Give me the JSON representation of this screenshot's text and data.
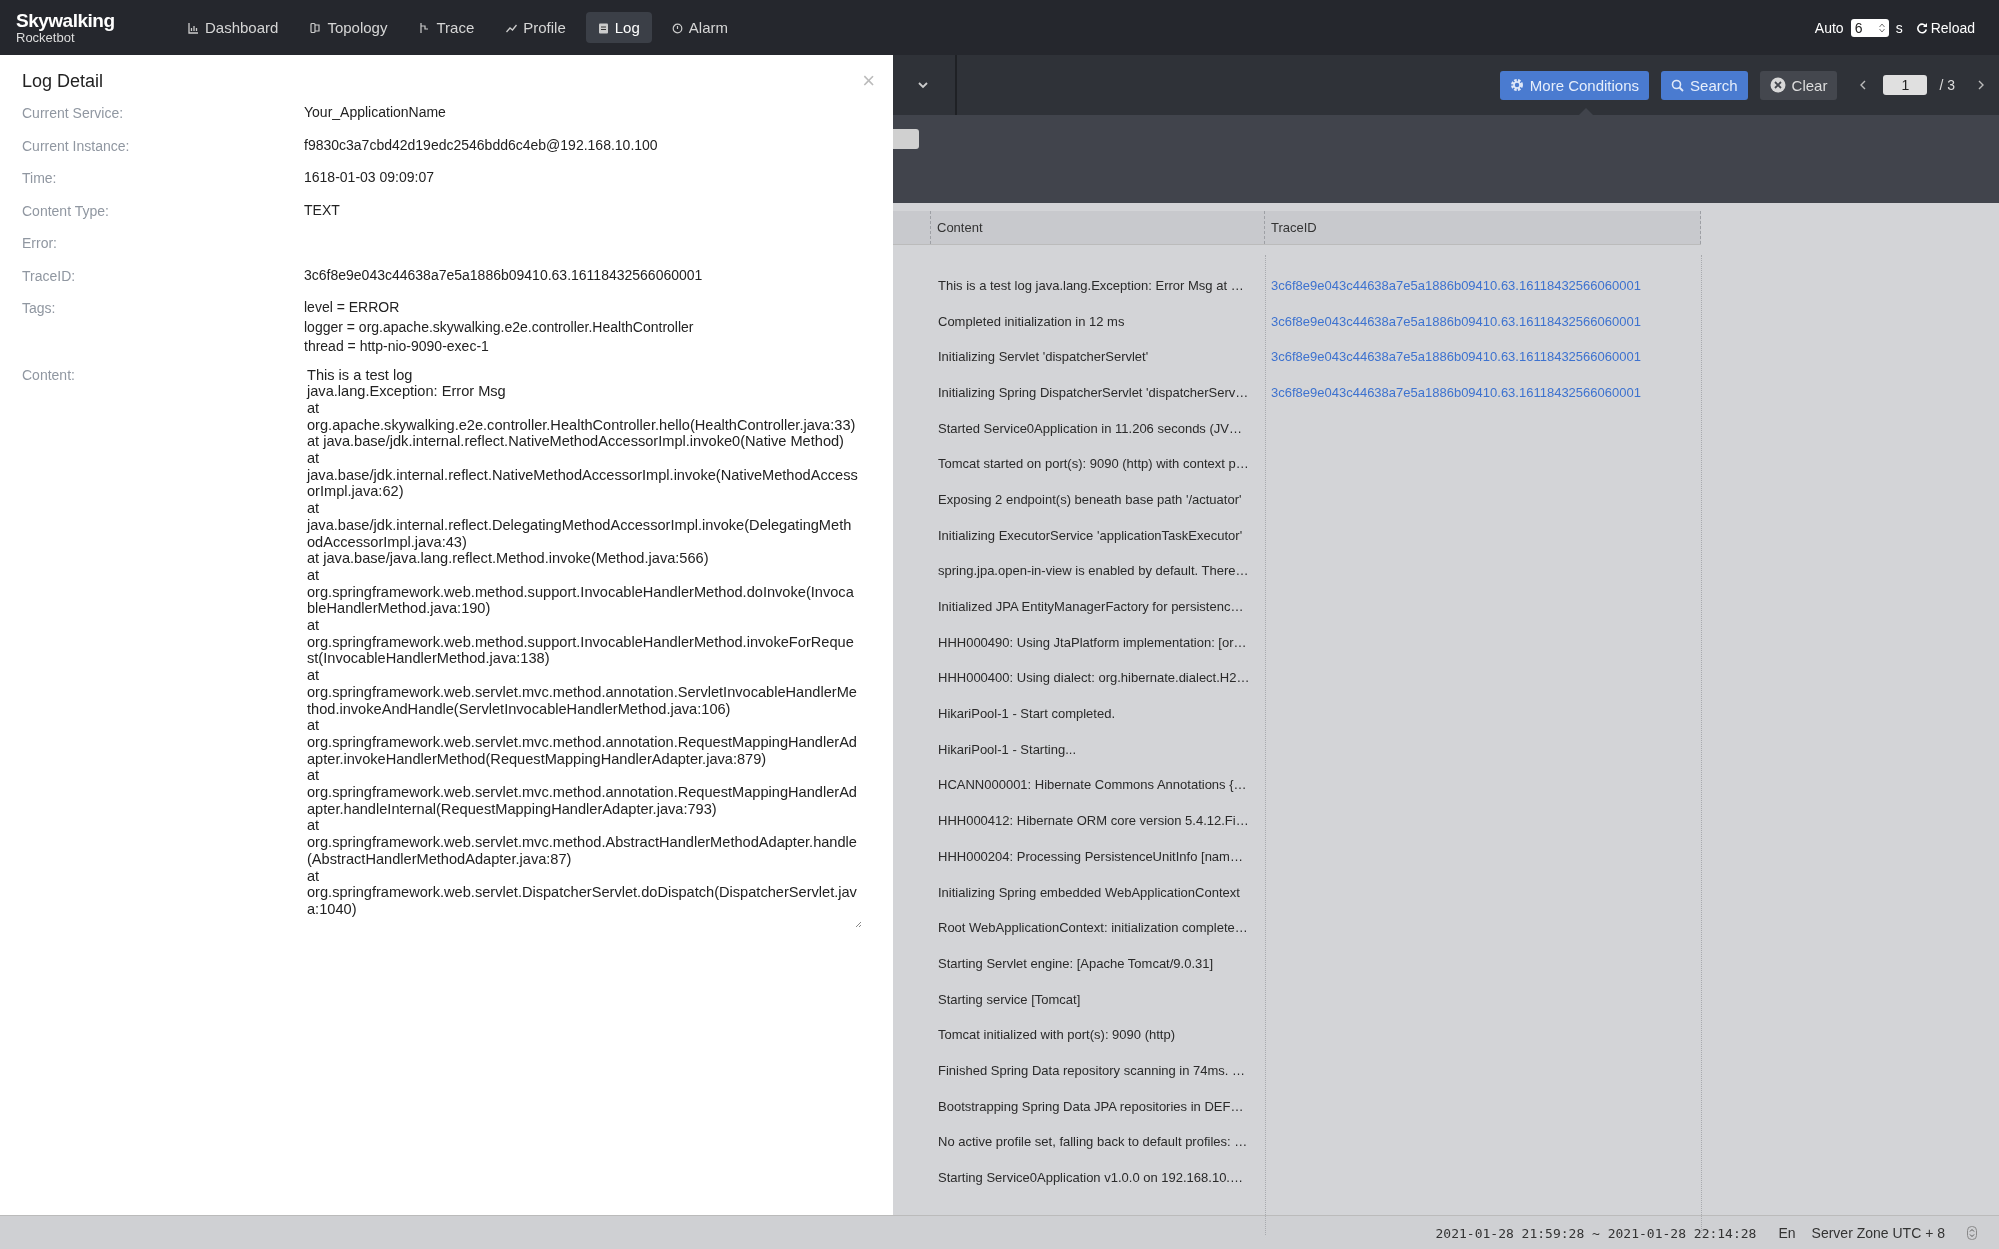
{
  "app": {
    "logo": "Skywalking",
    "subtitle": "Rocketbot"
  },
  "nav": [
    {
      "label": "Dashboard",
      "selected": false
    },
    {
      "label": "Topology",
      "selected": false
    },
    {
      "label": "Trace",
      "selected": false
    },
    {
      "label": "Profile",
      "selected": false
    },
    {
      "label": "Log",
      "selected": true
    },
    {
      "label": "Alarm",
      "selected": false
    }
  ],
  "auto_refresh": {
    "label": "Auto",
    "value": "6",
    "unit": "s",
    "reload": "Reload"
  },
  "toolbar": {
    "buttons": [
      {
        "label": "More Conditions",
        "kind": "primary"
      },
      {
        "label": "Search",
        "kind": "primary"
      },
      {
        "label": "Clear",
        "kind": "dark"
      }
    ],
    "page": "1",
    "page_total": "/ 3"
  },
  "table": {
    "columns": [
      "Content",
      "TraceID"
    ],
    "rows": [
      {
        "content": "This is a test log java.lang.Exception: Error Msg at …",
        "trace_id": "3c6f8e9e043c44638a7e5a1886b09410.63.16118432566060001"
      },
      {
        "content": "Completed initialization in 12 ms",
        "trace_id": "3c6f8e9e043c44638a7e5a1886b09410.63.16118432566060001"
      },
      {
        "content": "Initializing Servlet 'dispatcherServlet'",
        "trace_id": "3c6f8e9e043c44638a7e5a1886b09410.63.16118432566060001"
      },
      {
        "content": "Initializing Spring DispatcherServlet 'dispatcherServ…",
        "trace_id": "3c6f8e9e043c44638a7e5a1886b09410.63.16118432566060001"
      },
      {
        "content": "Started Service0Application in 11.206 seconds (JV…"
      },
      {
        "content": "Tomcat started on port(s): 9090 (http) with context p…"
      },
      {
        "content": "Exposing 2 endpoint(s) beneath base path '/actuator'"
      },
      {
        "content": "Initializing ExecutorService 'applicationTaskExecutor'"
      },
      {
        "content": "spring.jpa.open-in-view is enabled by default. There…"
      },
      {
        "content": "Initialized JPA EntityManagerFactory for persistenc…"
      },
      {
        "content": "HHH000490: Using JtaPlatform implementation: [or…"
      },
      {
        "content": "HHH000400: Using dialect: org.hibernate.dialect.H2…"
      },
      {
        "content": "HikariPool-1 - Start completed."
      },
      {
        "content": "HikariPool-1 - Starting..."
      },
      {
        "content": "HCANN000001: Hibernate Commons Annotations {…"
      },
      {
        "content": "HHH000412: Hibernate ORM core version 5.4.12.Fi…"
      },
      {
        "content": "HHH000204: Processing PersistenceUnitInfo [nam…"
      },
      {
        "content": "Initializing Spring embedded WebApplicationContext"
      },
      {
        "content": "Root WebApplicationContext: initialization complete…"
      },
      {
        "content": "Starting Servlet engine: [Apache Tomcat/9.0.31]"
      },
      {
        "content": "Starting service [Tomcat]"
      },
      {
        "content": "Tomcat initialized with port(s): 9090 (http)"
      },
      {
        "content": "Finished Spring Data repository scanning in 74ms. …"
      },
      {
        "content": "Bootstrapping Spring Data JPA repositories in DEF…"
      },
      {
        "content": "No active profile set, falling back to default profiles: …"
      },
      {
        "content": "Starting Service0Application v1.0.0 on 192.168.10.…"
      }
    ]
  },
  "drawer": {
    "title": "Log Detail",
    "close": "×",
    "fields": [
      {
        "label": "Current Service:",
        "lines": [
          "Your_ApplicationName"
        ]
      },
      {
        "label": "Current Instance:",
        "lines": [
          "f9830c3a7cbd42d19edc2546bdd6c4eb@192.168.10.100"
        ]
      },
      {
        "label": "Time:",
        "lines": [
          "1618-01-03 09:09:07"
        ]
      },
      {
        "label": "Content Type:",
        "lines": [
          "TEXT"
        ]
      },
      {
        "label": "Error:"
      },
      {
        "label": "TraceID:",
        "lines": [
          "3c6f8e9e043c44638a7e5a1886b09410.63.16118432566060001"
        ]
      },
      {
        "label": "Tags:",
        "lines": [
          "level = ERROR",
          "logger = org.apache.skywalking.e2e.controller.HealthController",
          "thread = http-nio-9090-exec-1"
        ]
      }
    ],
    "content_label": "Content:",
    "content": [
      "This is a test log",
      "java.lang.Exception: Error Msg",
      "at org.apache.skywalking.e2e.controller.HealthController.hello(HealthController.java:33)",
      "at java.base/jdk.internal.reflect.NativeMethodAccessorImpl.invoke0(Native Method)",
      "at java.base/jdk.internal.reflect.NativeMethodAccessorImpl.invoke(NativeMethodAccessorImpl.java:62)",
      "at java.base/jdk.internal.reflect.DelegatingMethodAccessorImpl.invoke(DelegatingMethodAccessorImpl.java:43)",
      "at java.base/java.lang.reflect.Method.invoke(Method.java:566)",
      "at org.springframework.web.method.support.InvocableHandlerMethod.doInvoke(InvocableHandlerMethod.java:190)",
      "at org.springframework.web.method.support.InvocableHandlerMethod.invokeForRequest(InvocableHandlerMethod.java:138)",
      "at org.springframework.web.servlet.mvc.method.annotation.ServletInvocableHandlerMethod.invokeAndHandle(ServletInvocableHandlerMethod.java:106)",
      "at org.springframework.web.servlet.mvc.method.annotation.RequestMappingHandlerAdapter.invokeHandlerMethod(RequestMappingHandlerAdapter.java:879)",
      "at org.springframework.web.servlet.mvc.method.annotation.RequestMappingHandlerAdapter.handleInternal(RequestMappingHandlerAdapter.java:793)",
      "at org.springframework.web.servlet.mvc.method.AbstractHandlerMethodAdapter.handle(AbstractHandlerMethodAdapter.java:87)",
      "at org.springframework.web.servlet.DispatcherServlet.doDispatch(DispatcherServlet.java:1040)"
    ]
  },
  "status_bar": {
    "time_range": "2021-01-28 21:59:28 ~ 2021-01-28 22:14:28",
    "language": "En",
    "zone": "Server Zone UTC + 8"
  }
}
